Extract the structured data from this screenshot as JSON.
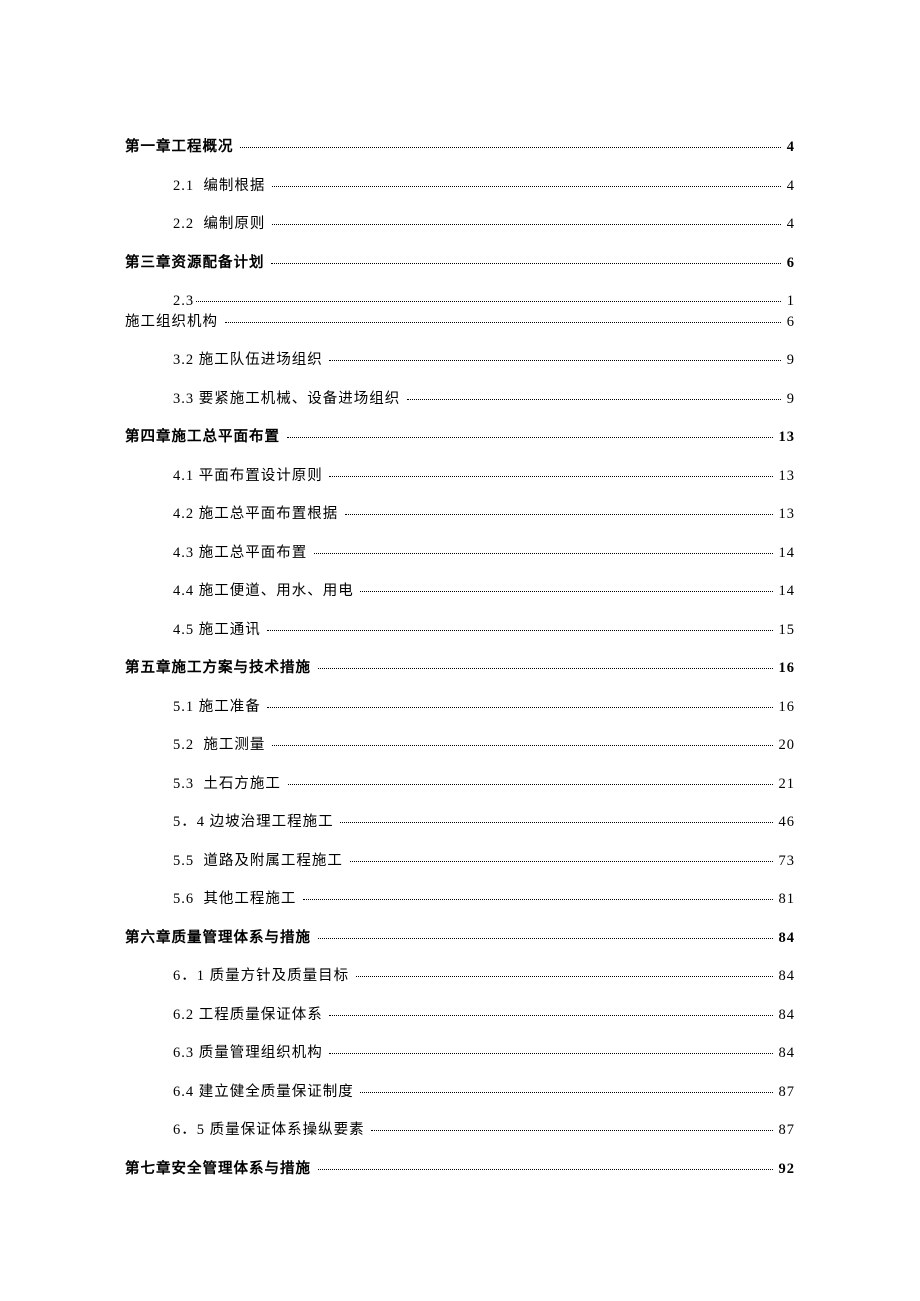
{
  "toc": [
    {
      "label": "第一章工程概况 ",
      "page": " 4",
      "level": 0,
      "bold": true,
      "tight": false
    },
    {
      "label": "2.1  编制根据 ",
      "page": " 4",
      "level": 1,
      "bold": false,
      "tight": false
    },
    {
      "label": "2.2  编制原则 ",
      "page": " 4",
      "level": 1,
      "bold": false,
      "tight": false
    },
    {
      "label": "第三章资源配备计划 ",
      "page": " 6",
      "level": 0,
      "bold": true,
      "tight": false
    },
    {
      "label": "2.3",
      "page": " 1",
      "level": 1,
      "bold": false,
      "tight": true
    },
    {
      "label": "施工组织机构 ",
      "page": " 6",
      "level": 0,
      "bold": false,
      "tight": false
    },
    {
      "label": "3.2 施工队伍进场组织 ",
      "page": " 9",
      "level": 1,
      "bold": false,
      "tight": false
    },
    {
      "label": "3.3 要紧施工机械、设备进场组织 ",
      "page": " 9",
      "level": 1,
      "bold": false,
      "tight": false
    },
    {
      "label": "第四章施工总平面布置 ",
      "page": " 13",
      "level": 0,
      "bold": true,
      "tight": false
    },
    {
      "label": "4.1 平面布置设计原则 ",
      "page": " 13",
      "level": 1,
      "bold": false,
      "tight": false
    },
    {
      "label": "4.2 施工总平面布置根据 ",
      "page": " 13",
      "level": 1,
      "bold": false,
      "tight": false
    },
    {
      "label": "4.3 施工总平面布置 ",
      "page": " 14",
      "level": 1,
      "bold": false,
      "tight": false
    },
    {
      "label": "4.4 施工便道、用水、用电 ",
      "page": " 14",
      "level": 1,
      "bold": false,
      "tight": false
    },
    {
      "label": "4.5 施工通讯 ",
      "page": " 15",
      "level": 1,
      "bold": false,
      "tight": false
    },
    {
      "label": "第五章施工方案与技术措施 ",
      "page": " 16",
      "level": 0,
      "bold": true,
      "tight": false
    },
    {
      "label": "5.1 施工准备 ",
      "page": " 16",
      "level": 1,
      "bold": false,
      "tight": false
    },
    {
      "label": "5.2  施工测量 ",
      "page": " 20",
      "level": 1,
      "bold": false,
      "tight": false
    },
    {
      "label": "5.3  土石方施工 ",
      "page": " 21",
      "level": 1,
      "bold": false,
      "tight": false
    },
    {
      "label": "5．4 边坡治理工程施工 ",
      "page": " 46",
      "level": 1,
      "bold": false,
      "tight": false
    },
    {
      "label": "5.5  道路及附属工程施工 ",
      "page": " 73",
      "level": 1,
      "bold": false,
      "tight": false
    },
    {
      "label": "5.6  其他工程施工 ",
      "page": " 81",
      "level": 1,
      "bold": false,
      "tight": false
    },
    {
      "label": "第六章质量管理体系与措施 ",
      "page": " 84",
      "level": 0,
      "bold": true,
      "tight": false
    },
    {
      "label": "6．1 质量方针及质量目标 ",
      "page": " 84",
      "level": 1,
      "bold": false,
      "tight": false
    },
    {
      "label": "6.2 工程质量保证体系 ",
      "page": " 84",
      "level": 1,
      "bold": false,
      "tight": false
    },
    {
      "label": "6.3 质量管理组织机构 ",
      "page": " 84",
      "level": 1,
      "bold": false,
      "tight": false
    },
    {
      "label": "6.4 建立健全质量保证制度 ",
      "page": " 87",
      "level": 1,
      "bold": false,
      "tight": false
    },
    {
      "label": "6．5 质量保证体系操纵要素 ",
      "page": " 87",
      "level": 1,
      "bold": false,
      "tight": false
    },
    {
      "label": "第七章安全管理体系与措施 ",
      "page": " 92",
      "level": 0,
      "bold": true,
      "tight": false
    }
  ]
}
